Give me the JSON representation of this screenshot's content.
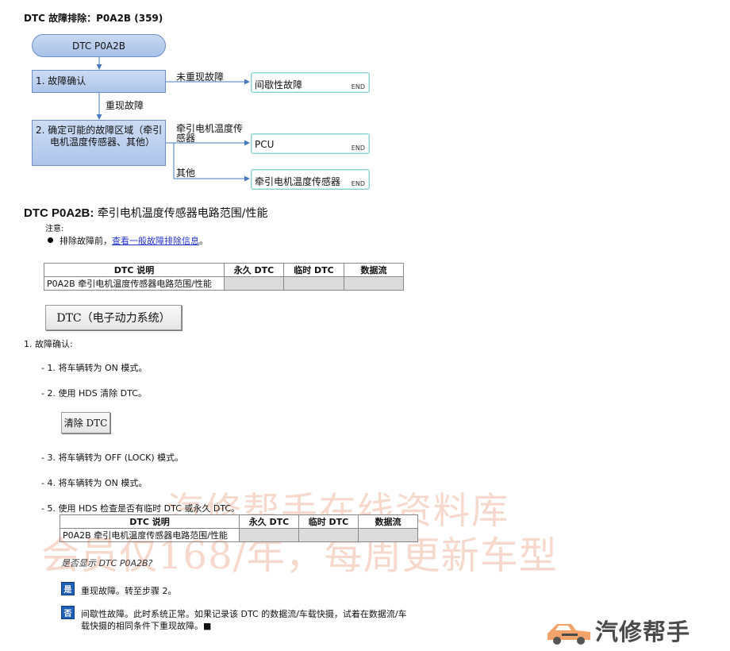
{
  "title": "DTC 故障排除：P0A2B (359)",
  "flowchart": {
    "start": "DTC P0A2B",
    "step1": "1.  故障确认",
    "step2_line1": "2.  确定可能的故障区域（牵引",
    "step2_line2": "电机温度传感器、其他）",
    "label_not_reproduced": "未重现故障",
    "label_reproduced": "重现故障",
    "label_sensor_line1": "牵引电机温度传",
    "label_sensor_line2": "感器",
    "label_other": "其他",
    "end1": "间歇性故障",
    "end2": "PCU",
    "end3": "牵引电机温度传感器",
    "end_label": "END",
    "box_color": "#b8cdee",
    "end_border_color": "#8ecfcf"
  },
  "section": {
    "code": "DTC P0A2B:",
    "name": "牵引电机温度传感器电路范围/性能",
    "note_label": "注意:",
    "bullet_prefix": "排除故障前，",
    "bullet_link": "查看一般故障排除信息",
    "bullet_suffix": "。"
  },
  "dtc_table": {
    "headers": [
      "DTC 说明",
      "永久 DTC",
      "临时 DTC",
      "数据流"
    ],
    "row": [
      "P0A2B 牵引电机温度传感器电路范围/性能",
      "",
      "",
      ""
    ]
  },
  "dtc_system_button": "DTC（电子动力系统）",
  "steps": {
    "step1_title": "1.  故障确认:",
    "sub1": "- 1.  将车辆转为 ON 模式。",
    "sub2": "- 2.  使用 HDS 清除 DTC。",
    "clear_button": "清除 DTC",
    "sub3": "- 3.  将车辆转为 OFF (LOCK) 模式。",
    "sub4": "- 4.  将车辆转为 ON 模式。",
    "sub5": "- 5.  使用 HDS 检查是否有临时 DTC 或永久 DTC。"
  },
  "dtc_table_2": {
    "headers": [
      "DTC 说明",
      "永久 DTC",
      "临时 DTC",
      "数据流"
    ],
    "row": [
      "P0A2B 牵引电机温度传感器电路范围/性能",
      "",
      "",
      ""
    ]
  },
  "question": "是否显示 DTC P0A2B?",
  "yes": {
    "icon": "是",
    "text": "重现故障。转至步骤 2。"
  },
  "no": {
    "icon": "否",
    "text_line1": "间歇性故障。此时系统正常。如果记录该 DTC 的数据流/车载快摄，试着在数据流/车",
    "text_line2": "载快摄的相同条件下重现故障。■"
  },
  "watermark": {
    "line1": "汽修帮手在线资料库",
    "line2": "会员仅168/年，每周更新车型"
  },
  "logo": {
    "text": "汽修帮手",
    "accent_color": "#f2a36a"
  }
}
